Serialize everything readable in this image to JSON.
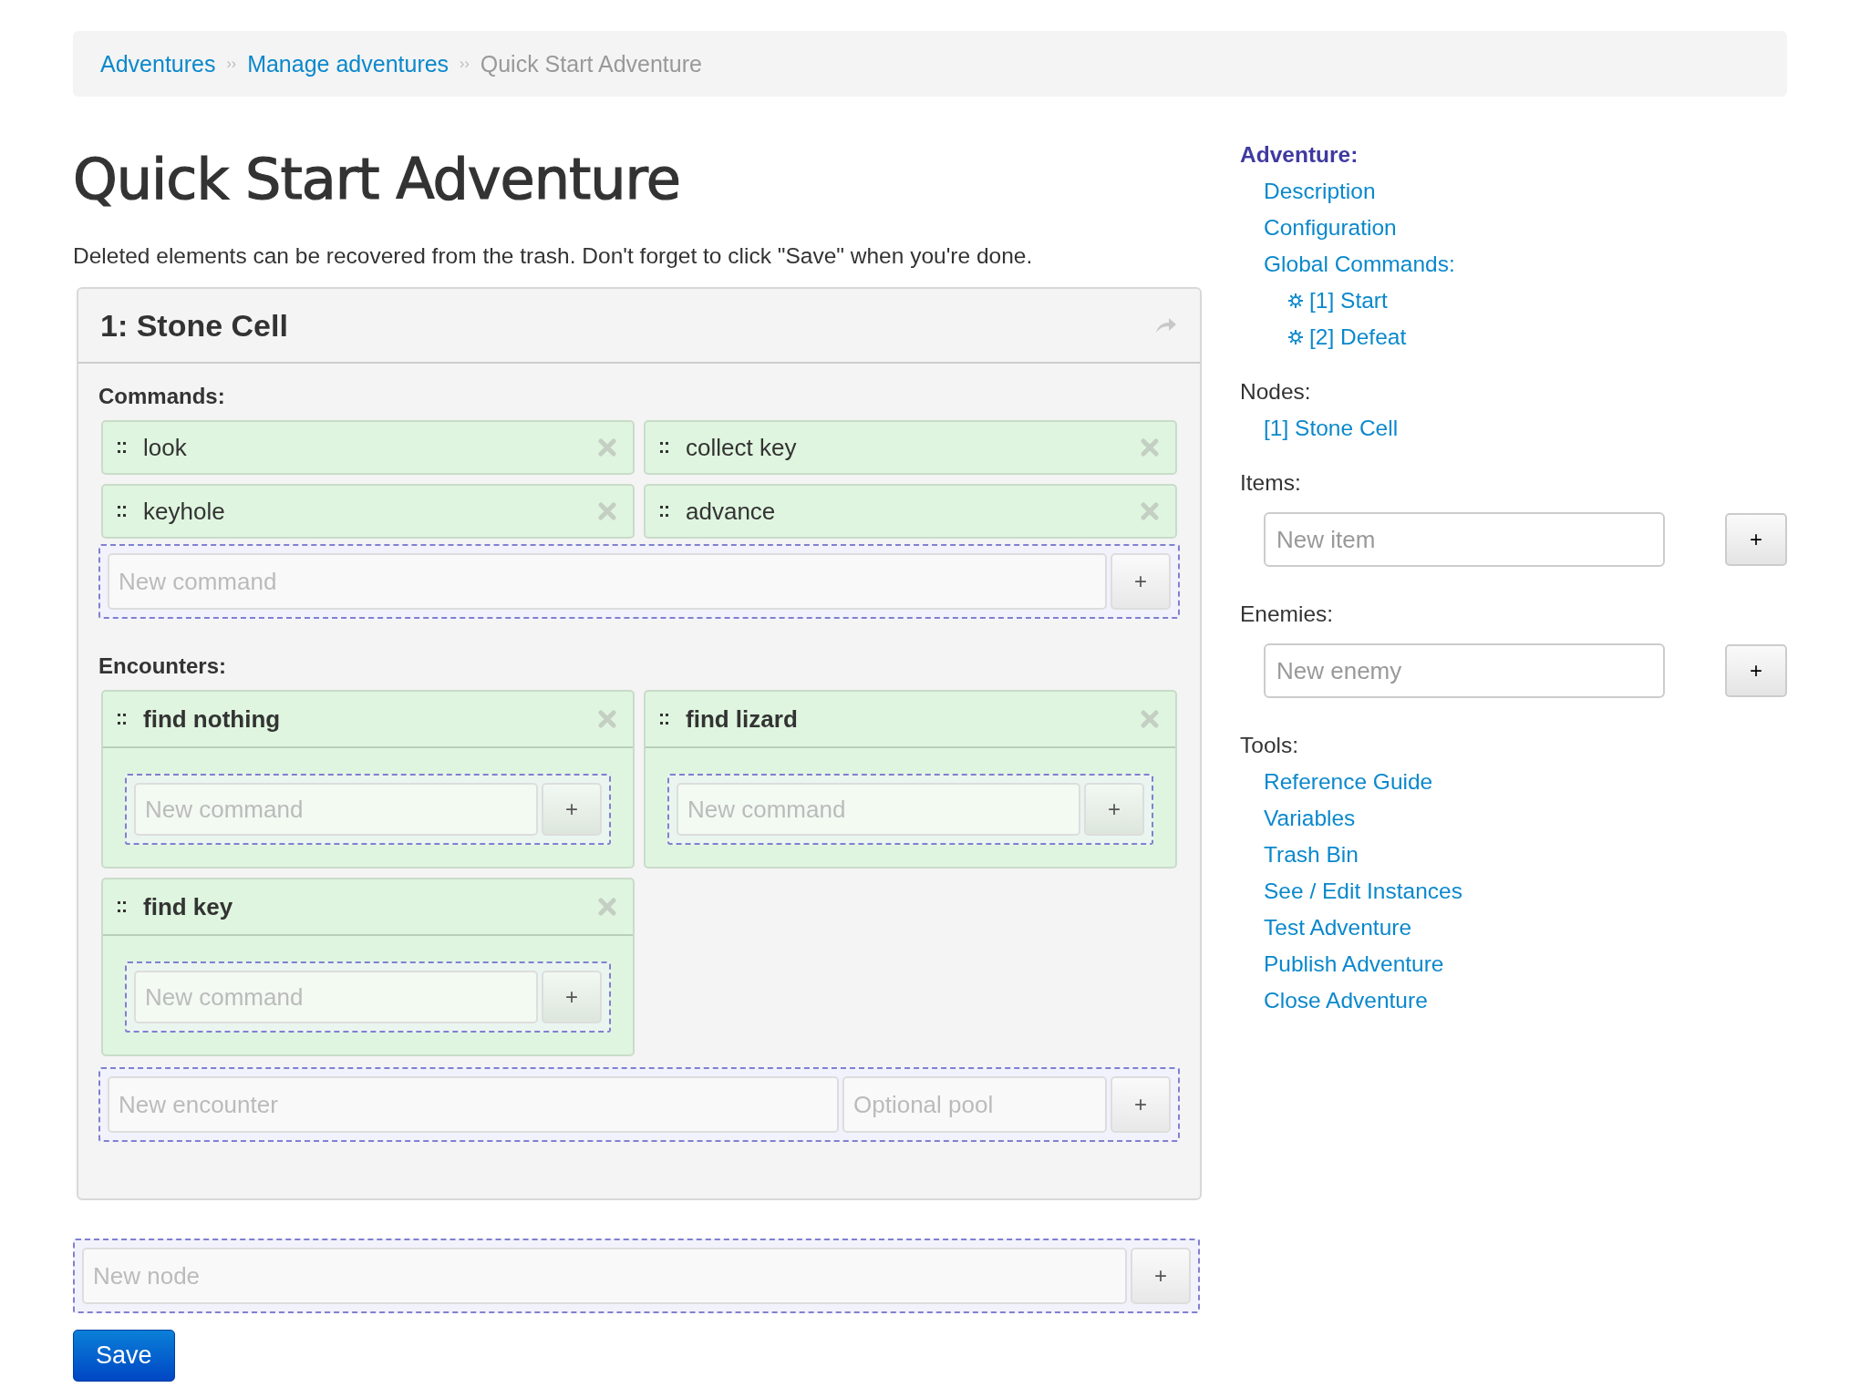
{
  "breadcrumb": {
    "separator": "››",
    "items": [
      {
        "label": "Adventures",
        "kind": "link"
      },
      {
        "label": "Manage adventures",
        "kind": "link"
      },
      {
        "label": "Quick Start Adventure",
        "kind": "current"
      }
    ]
  },
  "title": "Quick Start Adventure",
  "notice": "Deleted elements can be recovered from the trash. Don't forget to click \"Save\" when you're done.",
  "node": {
    "title": "1: Stone Cell",
    "commands_label": "Commands:",
    "commands": [
      "look",
      "collect key",
      "keyhole",
      "advance"
    ],
    "new_command": {
      "placeholder": "New command",
      "button": "+"
    },
    "encounters_label": "Encounters:",
    "encounters": [
      {
        "name": "find nothing",
        "new_command": {
          "placeholder": "New command",
          "button": "+"
        }
      },
      {
        "name": "find lizard",
        "new_command": {
          "placeholder": "New command",
          "button": "+"
        }
      },
      {
        "name": "find key",
        "new_command": {
          "placeholder": "New command",
          "button": "+"
        }
      }
    ],
    "new_encounter": {
      "placeholder": "New encounter",
      "pool_placeholder": "Optional pool",
      "button": "+"
    }
  },
  "new_node": {
    "placeholder": "New node",
    "button": "+"
  },
  "save_button": "Save",
  "sidebar": [
    {
      "kind": "heading",
      "label": "Adventure:"
    },
    {
      "kind": "link",
      "label": "Description"
    },
    {
      "kind": "link",
      "label": "Configuration"
    },
    {
      "kind": "link",
      "label": "Global Commands:"
    },
    {
      "kind": "sublink",
      "label": "[1] Start"
    },
    {
      "kind": "sublink",
      "label": "[2] Defeat"
    },
    {
      "kind": "label",
      "label": "Nodes:"
    },
    {
      "kind": "link",
      "label": "[1] Stone Cell"
    },
    {
      "kind": "label",
      "label": "Items:"
    },
    {
      "kind": "field",
      "placeholder": "New item",
      "button": "+"
    },
    {
      "kind": "label",
      "label": "Enemies:"
    },
    {
      "kind": "field",
      "placeholder": "New enemy",
      "button": "+"
    },
    {
      "kind": "label",
      "label": "Tools:"
    },
    {
      "kind": "link",
      "label": "Reference Guide"
    },
    {
      "kind": "link",
      "label": "Variables"
    },
    {
      "kind": "link",
      "label": "Trash Bin"
    },
    {
      "kind": "link",
      "label": "See / Edit Instances"
    },
    {
      "kind": "link",
      "label": "Test Adventure"
    },
    {
      "kind": "link",
      "label": "Publish Adventure"
    },
    {
      "kind": "link",
      "label": "Close Adventure"
    }
  ]
}
